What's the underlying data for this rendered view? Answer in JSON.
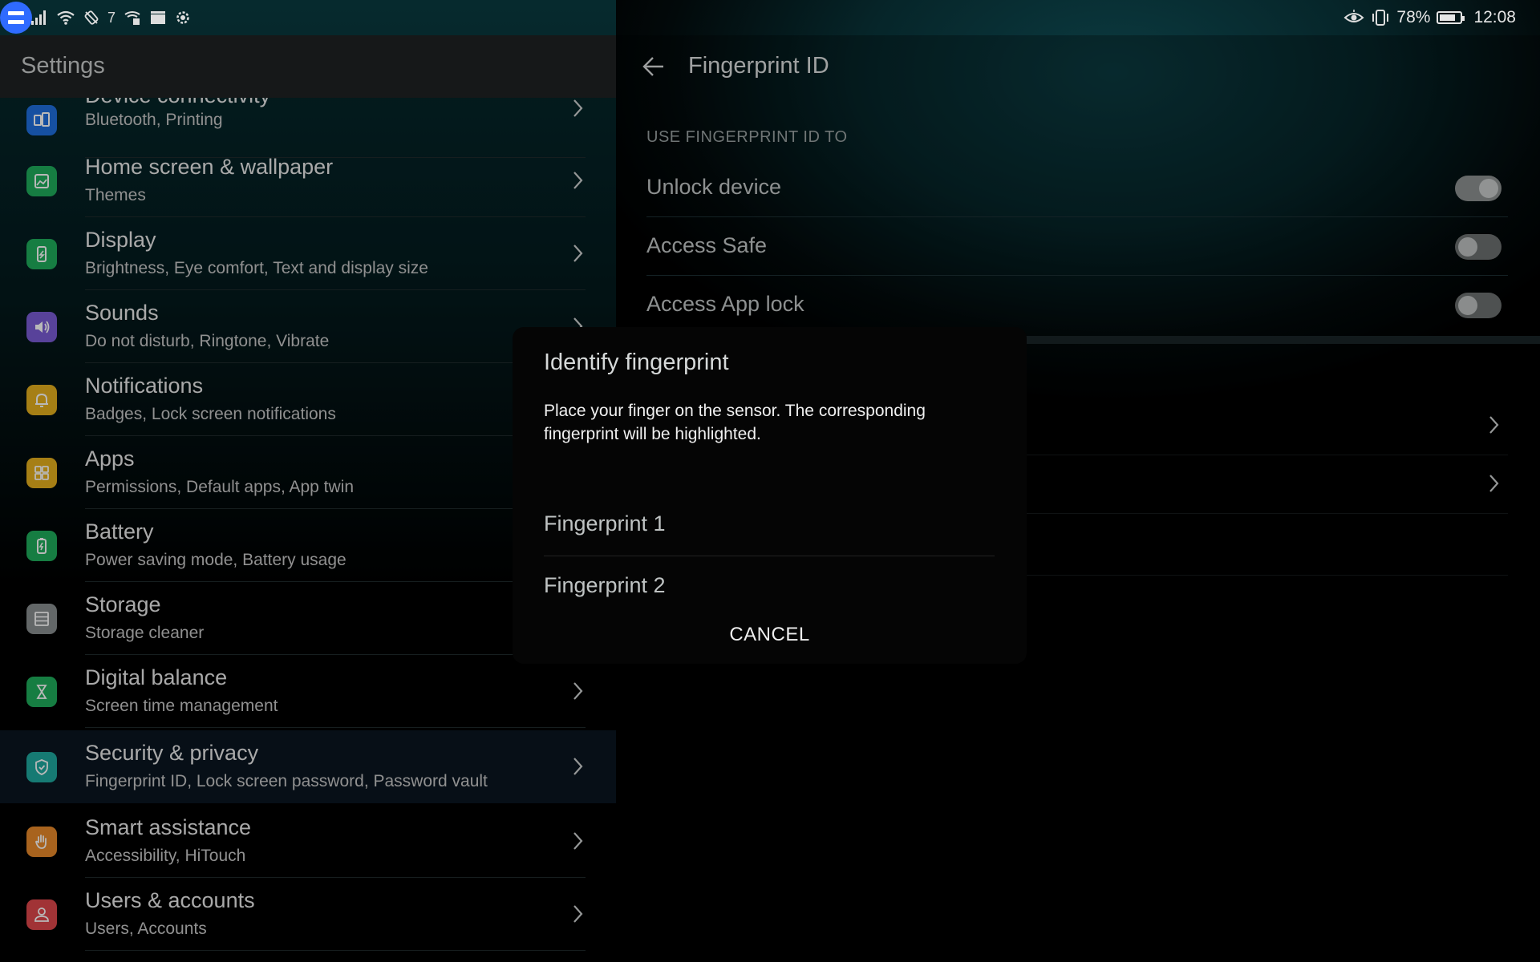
{
  "status_bar": {
    "battery_percent": "78%",
    "battery_level": 0.78,
    "time": "12:08",
    "notif_count": "7"
  },
  "left": {
    "header_title": "Settings",
    "items": [
      {
        "title": "Device connectivity",
        "subtitle": "Bluetooth, Printing",
        "icon": "device-connectivity-icon",
        "color": "#1f6fe0"
      },
      {
        "title": "Home screen & wallpaper",
        "subtitle": "Themes",
        "icon": "wallpaper-icon",
        "color": "#1fae5c"
      },
      {
        "title": "Display",
        "subtitle": "Brightness, Eye comfort, Text and display size",
        "icon": "display-icon",
        "color": "#1fae5c"
      },
      {
        "title": "Sounds",
        "subtitle": "Do not disturb, Ringtone, Vibrate",
        "icon": "sound-icon",
        "color": "#7b5cd6"
      },
      {
        "title": "Notifications",
        "subtitle": "Badges, Lock screen notifications",
        "icon": "bell-icon",
        "color": "#e6b01e"
      },
      {
        "title": "Apps",
        "subtitle": "Permissions, Default apps, App twin",
        "icon": "apps-grid-icon",
        "color": "#e6b01e"
      },
      {
        "title": "Battery",
        "subtitle": "Power saving mode, Battery usage",
        "icon": "battery-icon",
        "color": "#1fae5c"
      },
      {
        "title": "Storage",
        "subtitle": "Storage cleaner",
        "icon": "storage-icon",
        "color": "#8a8f91"
      },
      {
        "title": "Digital balance",
        "subtitle": "Screen time management",
        "icon": "hourglass-icon",
        "color": "#1fae5c"
      },
      {
        "title": "Security & privacy",
        "subtitle": "Fingerprint ID, Lock screen password, Password vault",
        "icon": "shield-icon",
        "color": "#1fa9a0"
      },
      {
        "title": "Smart assistance",
        "subtitle": "Accessibility, HiTouch",
        "icon": "hand-icon",
        "color": "#e9892a"
      },
      {
        "title": "Users & accounts",
        "subtitle": "Users, Accounts",
        "icon": "user-icon",
        "color": "#e0474c"
      }
    ]
  },
  "right": {
    "title": "Fingerprint ID",
    "section_label": "USE FINGERPRINT ID TO",
    "toggles": [
      {
        "label": "Unlock device",
        "on": true
      },
      {
        "label": "Access Safe",
        "on": false
      },
      {
        "label": "Access App lock",
        "on": false
      }
    ]
  },
  "dialog": {
    "title": "Identify fingerprint",
    "message": "Place your finger on the sensor. The corresponding fingerprint will be highlighted.",
    "items": [
      "Fingerprint 1",
      "Fingerprint 2"
    ],
    "cancel_label": "CANCEL"
  }
}
